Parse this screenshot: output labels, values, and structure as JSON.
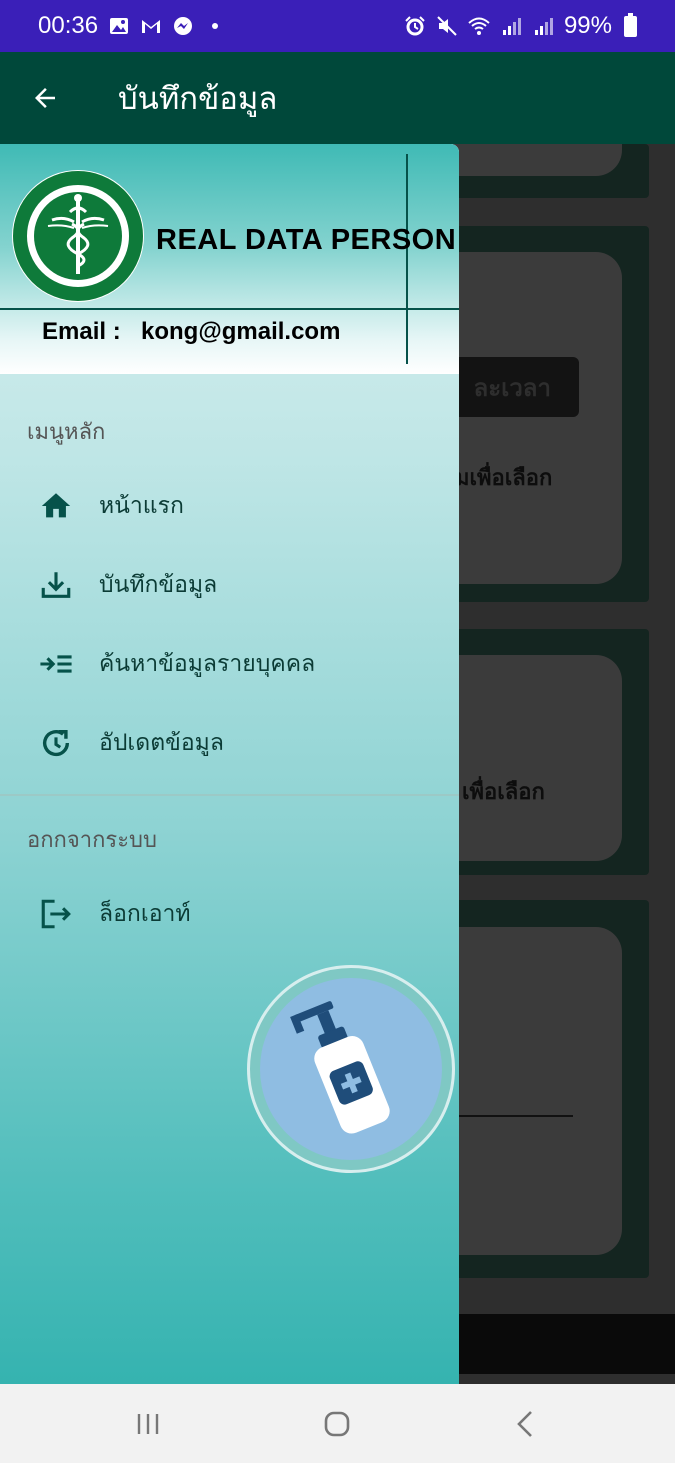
{
  "status_bar": {
    "time": "00:36",
    "battery": "99%",
    "left_icons": [
      "gallery-icon",
      "gmail-icon",
      "messenger-icon",
      "dot-icon"
    ],
    "right_icons": [
      "alarm-icon",
      "mute-icon",
      "wifi-icon",
      "signal-icon",
      "signal-icon",
      "battery-icon"
    ]
  },
  "app_bar": {
    "title": "บันทึกข้อมูล",
    "back_icon": "arrow-back-icon"
  },
  "drawer": {
    "header": {
      "org_name": "REAL DATA PERSON",
      "email_label": "Email :",
      "email_value": "kong@gmail.com",
      "logo_icon": "ministry-of-public-health-logo"
    },
    "main_section_title": "เมนูหลัก",
    "main_items": [
      {
        "label": "หน้าแรก",
        "icon": "home-icon"
      },
      {
        "label": "บันทึกข้อมูล",
        "icon": "download-icon"
      },
      {
        "label": "ค้นหาข้อมูลรายบุคคล",
        "icon": "search-list-icon"
      },
      {
        "label": "อัปเดตข้อมูล",
        "icon": "update-icon"
      }
    ],
    "exit_section_title": "อกกจากระบบ",
    "exit_items": [
      {
        "label": "ล็อกเอาท์",
        "icon": "logout-icon"
      }
    ],
    "illustration_icon": "hand-sanitizer-icon"
  },
  "background": {
    "button_text": "ละเวลา",
    "text_1": "มเพื่อเลือก",
    "text_2": "เพื่อเลือก"
  },
  "nav_bar": {
    "icons": [
      "recent-apps-icon",
      "home-circle-icon",
      "back-chevron-icon"
    ]
  },
  "colors": {
    "status_bar": "#3a1fb8",
    "app_bar": "#00483a",
    "drawer_top": "#dff2f2",
    "drawer_bottom": "#35b3b0",
    "accent": "#06524a"
  }
}
